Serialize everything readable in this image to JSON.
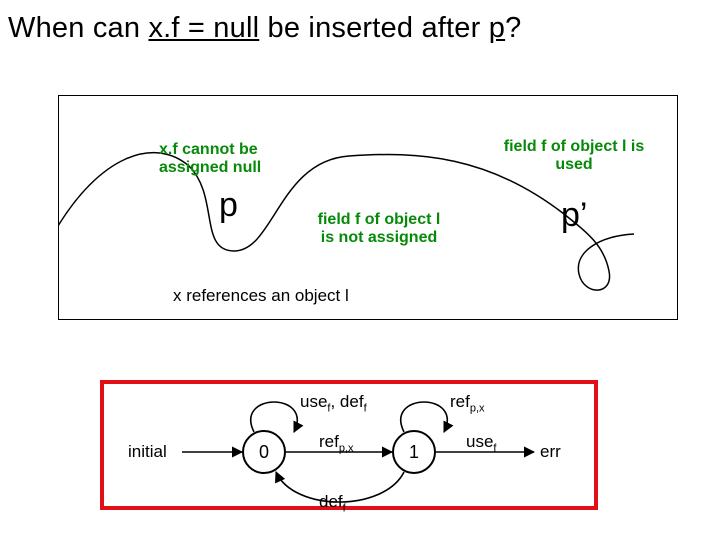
{
  "title": {
    "part1": "When can ",
    "underline1": "x.f = null",
    "part2": " be inserted after ",
    "underline2": "p",
    "part3": "?"
  },
  "top": {
    "note_cannot": "x.f cannot be\nassigned null",
    "p": "p",
    "note_notassigned": "field f of object l\nis not assigned",
    "note_used": "field f of object l is\nused",
    "p_prime": "p’",
    "x_refs": "x references an object l"
  },
  "automaton": {
    "initial": "initial",
    "state0": "0",
    "state1": "1",
    "err": "err",
    "edge_top": {
      "a": "use",
      "asub": "f",
      "b": ", def",
      "bsub": "f"
    },
    "edge_mid": {
      "a": "ref",
      "asub": "p,x"
    },
    "edge_bot": {
      "a": "def",
      "asub": "f"
    },
    "edge_r1": {
      "a": "ref",
      "asub": "p,x"
    },
    "edge_r2": {
      "a": "use",
      "asub": "f"
    }
  }
}
